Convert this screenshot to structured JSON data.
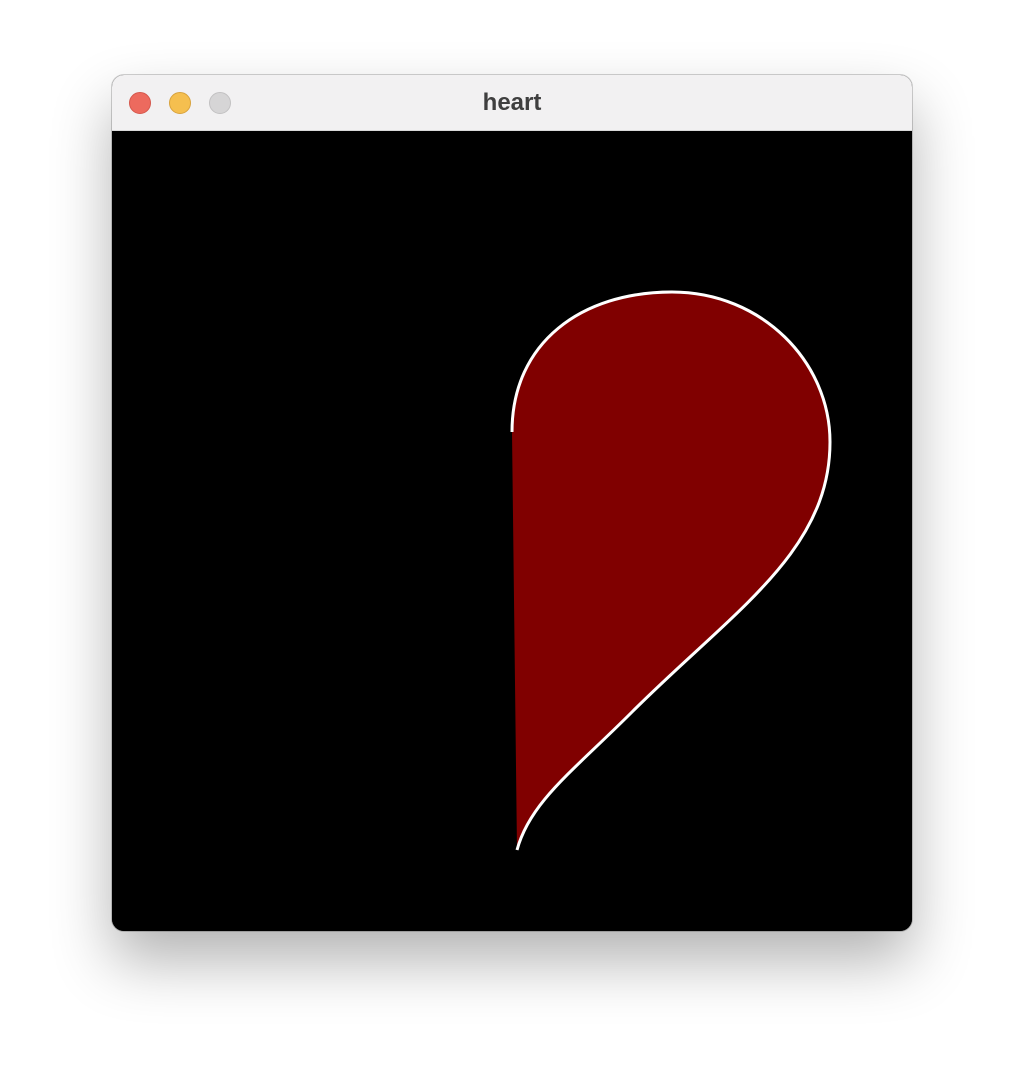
{
  "window": {
    "title": "heart"
  },
  "titlebar": {
    "buttons": [
      {
        "name": "close",
        "icon": "close-traffic-light",
        "color": "#ed6a5e"
      },
      {
        "name": "minimize",
        "icon": "minimize-traffic-light",
        "color": "#f5bf4f"
      },
      {
        "name": "zoom",
        "icon": "zoom-traffic-light",
        "color": "#d6d5d6"
      }
    ]
  },
  "canvas": {
    "background": "#000000",
    "shape": {
      "name": "half-heart",
      "fill": "#800000",
      "outline": "#ffffff"
    }
  }
}
